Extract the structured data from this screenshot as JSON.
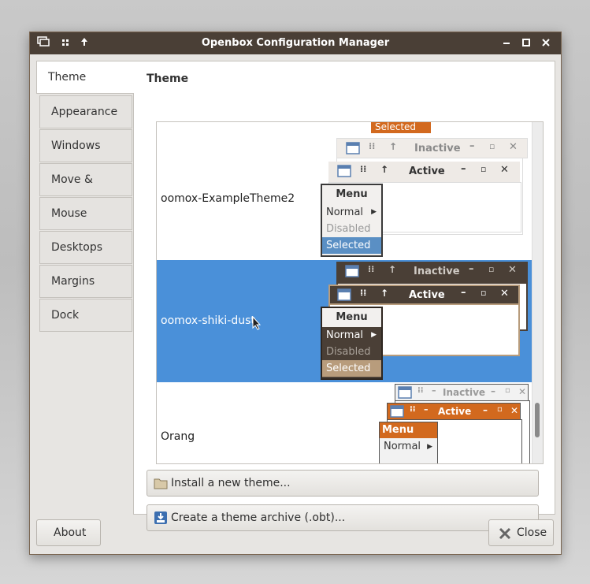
{
  "window": {
    "title": "Openbox Configuration Manager",
    "titlebar_left_icons": [
      "window-icon",
      "pin-icon",
      "shade-icon"
    ],
    "titlebar_right_icons": [
      "minimize-icon",
      "maximize-icon",
      "close-icon"
    ]
  },
  "tabs": [
    {
      "label": "Theme",
      "active": true
    },
    {
      "label": "Appearance",
      "active": false
    },
    {
      "label": "Windows",
      "active": false
    },
    {
      "label": "Move & Resize",
      "active": false
    },
    {
      "label": "Mouse",
      "active": false
    },
    {
      "label": "Desktops",
      "active": false
    },
    {
      "label": "Margins",
      "active": false
    },
    {
      "label": "Dock",
      "active": false
    }
  ],
  "theme_panel": {
    "title": "Theme",
    "themes": [
      {
        "name": "oomox-ExampleTheme2",
        "selected": false
      },
      {
        "name": "oomox-shiki-dust",
        "selected": true
      },
      {
        "name": "Orang",
        "selected": false
      }
    ],
    "preview": {
      "selected_top": "Selected",
      "inactive": "Inactive",
      "active": "Active",
      "menu": "Menu",
      "normal": "Normal",
      "disabled": "Disabled",
      "selected": "Selected"
    },
    "install_button": "Install a new theme...",
    "archive_button": "Create a theme archive (.obt)..."
  },
  "footer": {
    "about_button": "About",
    "close_button": "Close"
  },
  "colors": {
    "titlebar": "#4a3f36",
    "selection": "#4a90d9",
    "accent_orange": "#d2691e",
    "shiki_accent": "#b89c7c"
  }
}
